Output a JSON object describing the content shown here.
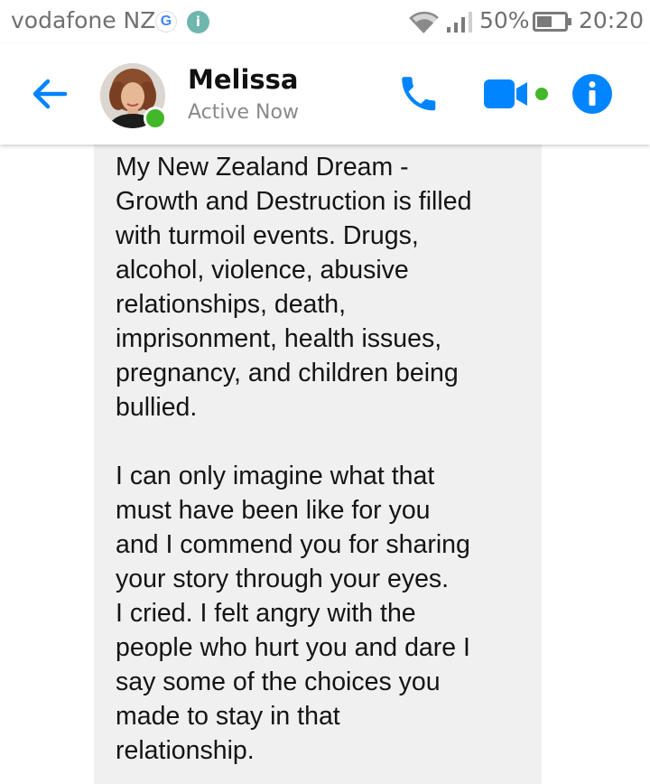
{
  "status_bar": {
    "carrier": "vodafone NZ",
    "google_icon": "google-g-icon",
    "notification_icon": "i",
    "battery_percent": "50%",
    "time": "20:20"
  },
  "header": {
    "contact_name": "Melissa",
    "contact_status": "Active Now",
    "presence_color": "#42b72a",
    "accent_color": "#0084ff"
  },
  "message": {
    "bubble_color": "#f0f0f0",
    "lines": [
      "My New Zealand Dream -",
      "Growth and Destruction is filled",
      "with turmoil events. Drugs,",
      "alcohol, violence, abusive",
      "relationships, death,",
      "imprisonment, health issues,",
      "pregnancy, and children being",
      "bullied.",
      "",
      "I can only imagine what that",
      "must have been like for you",
      "and I commend you for sharing",
      "your story through your eyes.",
      "I cried. I felt angry with the",
      "people who hurt you and dare I",
      "say some of the choices you",
      "made to stay in that",
      "relationship."
    ]
  }
}
